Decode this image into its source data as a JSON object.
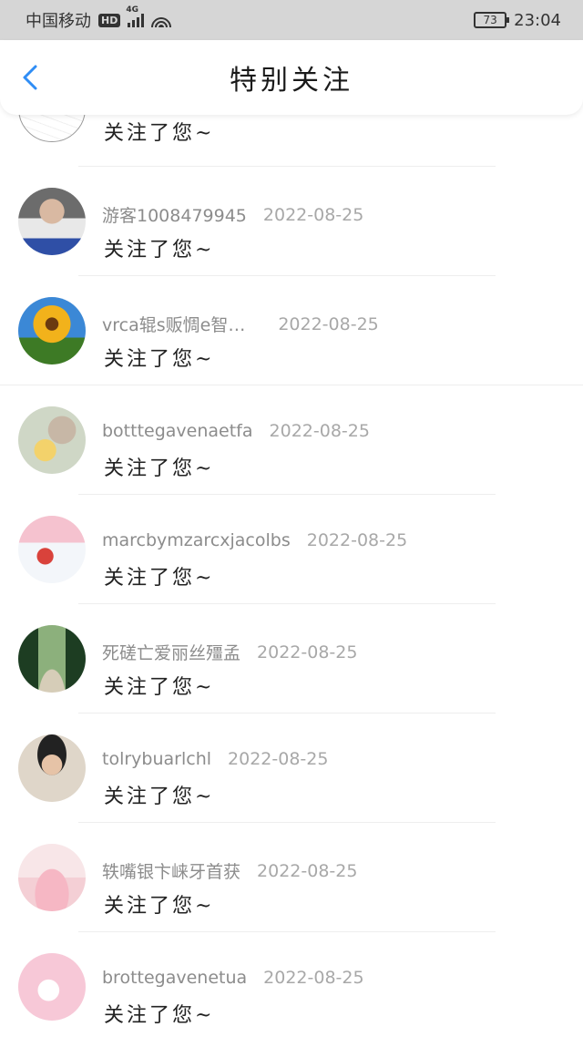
{
  "status_bar": {
    "carrier": "中国移动",
    "hd": "HD",
    "network": "4G",
    "battery": "73",
    "time": "23:04"
  },
  "header": {
    "title": "特别关注"
  },
  "list": {
    "partial_message": "关注了您~",
    "items": [
      {
        "name": "游客1008479945",
        "date": "2022-08-25",
        "message": "关注了您~"
      },
      {
        "name": "vrca辊s贩惆e智…",
        "date": "2022-08-25",
        "message": "关注了您~"
      },
      {
        "name": "botttegavenaetfa",
        "date": "2022-08-25",
        "message": "关注了您~"
      },
      {
        "name": "marcbymzarcxjacolbs",
        "date": "2022-08-25",
        "message": "关注了您~"
      },
      {
        "name": "死磋亡爱丽丝殭孟",
        "date": "2022-08-25",
        "message": "关注了您~"
      },
      {
        "name": "tolrybuarlchl",
        "date": "2022-08-25",
        "message": "关注了您~"
      },
      {
        "name": "轶嘴银卞崃牙首获",
        "date": "2022-08-25",
        "message": "关注了您~"
      },
      {
        "name": "brottegavenetua",
        "date": "2022-08-25",
        "message": "关注了您~"
      }
    ]
  }
}
